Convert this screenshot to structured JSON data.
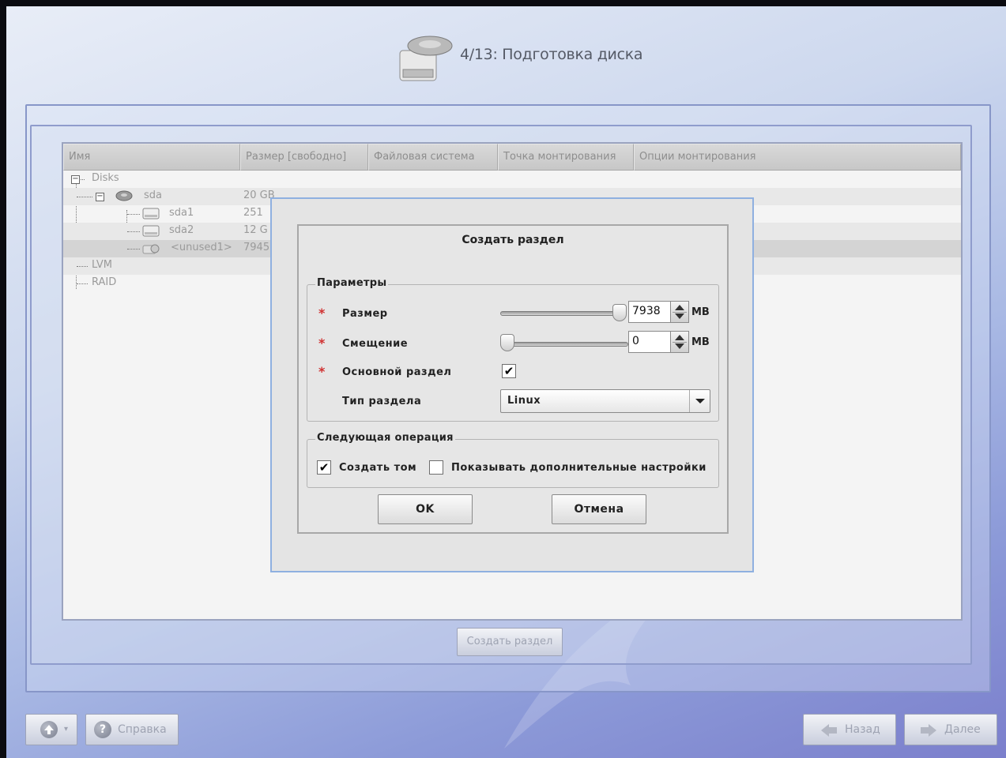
{
  "header": {
    "step_title": "4/13: Подготовка диска",
    "icon": "disk-drive-icon"
  },
  "table": {
    "columns": [
      "Имя",
      "Размер [свободно]",
      "Файловая система",
      "Точка монтирования",
      "Опции монтирования"
    ],
    "rows": [
      {
        "name": "Disks",
        "size": ""
      },
      {
        "name": "sda",
        "size": "20 GB"
      },
      {
        "name": "sda1",
        "size": "251"
      },
      {
        "name": "sda2",
        "size": "12 G"
      },
      {
        "name": "<unused1>",
        "size": "7945"
      },
      {
        "name": "LVM",
        "size": ""
      },
      {
        "name": "RAID",
        "size": ""
      }
    ]
  },
  "create_partition_button": "Создать раздел",
  "dialog": {
    "title": "Создать раздел",
    "params_group": "Параметры",
    "size_label": "Размер",
    "size_value": "7938",
    "size_unit": "MB",
    "offset_label": "Смещение",
    "offset_value": "0",
    "offset_unit": "MB",
    "primary_label": "Основной раздел",
    "primary_checked": "✔",
    "type_label": "Тип раздела",
    "type_value": "Linux",
    "next_group": "Следующая операция",
    "create_volume_label": "Создать том",
    "create_volume_checked": "✔",
    "show_advanced_label": "Показывать дополнительные настройки",
    "ok_label": "OK",
    "cancel_label": "Отмена"
  },
  "footer": {
    "help_label": "Справка",
    "back_label": "Назад",
    "next_label": "Далее"
  }
}
